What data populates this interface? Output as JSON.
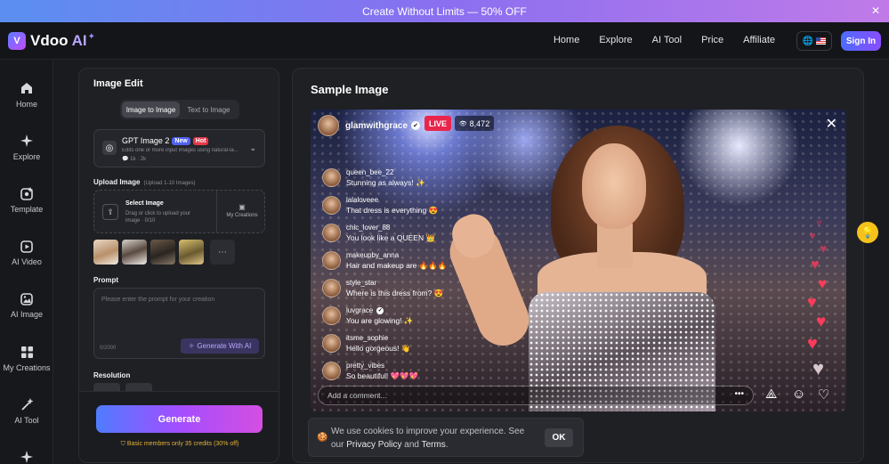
{
  "banner": {
    "text": "Create Without Limits — 50% OFF",
    "close": "✕"
  },
  "brand": {
    "logo_mark": "V",
    "name": "Vdoo",
    "ai": "AI",
    "spark": "✦"
  },
  "nav": {
    "links": [
      "Home",
      "Explore",
      "AI Tool",
      "Price",
      "Affiliate"
    ],
    "globe": "🌐",
    "signin": "Sign In"
  },
  "sidebar": {
    "items": [
      {
        "label": "Home",
        "icon": "home-icon"
      },
      {
        "label": "Explore",
        "icon": "sparkle-icon"
      },
      {
        "label": "Template",
        "icon": "template-icon"
      },
      {
        "label": "AI Video",
        "icon": "video-icon"
      },
      {
        "label": "AI Image",
        "icon": "image-icon"
      },
      {
        "label": "My Creations",
        "icon": "grid-icon"
      },
      {
        "label": "AI Tool",
        "icon": "wand-icon"
      }
    ]
  },
  "left": {
    "title": "Image Edit",
    "tabs": [
      "Image to Image",
      "Text to Image"
    ],
    "model": {
      "icon": "◎",
      "name": "GPT Image 2",
      "badge_new": "New",
      "badge_hot": "Hot",
      "desc": "Edits one or more input images using natural-la...",
      "stats": "💬 1k · 2k",
      "chevron": "⌄"
    },
    "upload": {
      "label": "Upload Image",
      "sub": "(Upload 1-10 Images)",
      "title": "Select Image",
      "desc": "Drag or click to upload your image · 0/10",
      "my_creations": "My Creations",
      "icon": "⇪",
      "mc_icon": "▣"
    },
    "more": "⋯",
    "prompt": {
      "label": "Prompt",
      "placeholder": "Please enter the prompt for your creation",
      "count": "0/2000",
      "gen_ai": "Generate With AI",
      "gen_icon": "✧"
    },
    "resolution": {
      "label": "Resolution"
    },
    "generate": "Generate",
    "note": "Basic members only 35 credits (30% off)",
    "note_icon": "⛉"
  },
  "right": {
    "title": "Sample Image",
    "stream": {
      "user": "glamwithgrace",
      "verified": "✔",
      "live": "LIVE",
      "viewers": "8,472",
      "viewers_icon": "👁",
      "close": "✕",
      "comments": [
        {
          "user": "queen_bee_22",
          "msg": "Stunning as always! ✨",
          "verified": false
        },
        {
          "user": "lalaloveee",
          "msg": "That dress is everything 😍",
          "verified": false
        },
        {
          "user": "chic_lover_88",
          "msg": "You look like a QUEEN 👑",
          "verified": false
        },
        {
          "user": "makeupby_anna",
          "msg": "Hair and makeup are 🔥🔥🔥",
          "verified": false
        },
        {
          "user": "style_star",
          "msg": "Where is this dress from? 😍",
          "verified": false
        },
        {
          "user": "luvgrace",
          "msg": "You are glowing! ✨",
          "verified": true
        },
        {
          "user": "itsme_sophie",
          "msg": "Hello gorgeous! 👋",
          "verified": false
        },
        {
          "user": "pretty_vibes",
          "msg": "So beautiful! 💖💖💖",
          "verified": false
        }
      ],
      "comment_placeholder": "Add a comment...",
      "dots": "•••",
      "send": "⟁",
      "emoji": "☺",
      "like": "♡",
      "heart": "♥"
    }
  },
  "help": {
    "icon": "💡"
  },
  "cookie": {
    "icon": "🍪",
    "text": "We use cookies to improve your experience. See our",
    "privacy": "Privacy Policy",
    "and": "and",
    "terms": "Terms",
    "end": ".",
    "ok": "OK"
  }
}
